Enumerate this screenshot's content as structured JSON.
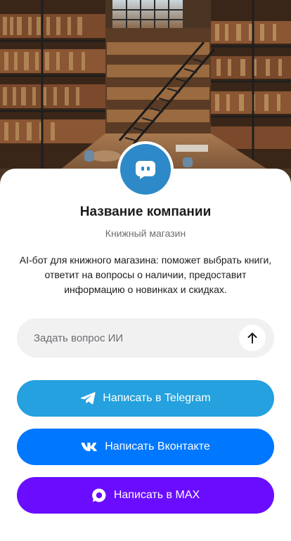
{
  "company": {
    "name": "Название компании",
    "category": "Книжный магазин",
    "description": "AI-бот для книжного магазина: поможет выбрать книги, ответит на вопросы о наличии, предоставит информацию о новинках и скидках."
  },
  "avatar": {
    "icon": "chat-bubble-icon",
    "color": "#2d89c8"
  },
  "ask": {
    "placeholder": "Задать вопрос ИИ",
    "value": "",
    "send_icon": "arrow-up-icon"
  },
  "buttons": {
    "telegram": {
      "label": "Написать в Telegram",
      "icon": "telegram-icon",
      "color": "#24a1de"
    },
    "vk": {
      "label": "Написать Вконтакте",
      "icon": "vk-icon",
      "color": "#0077ff"
    },
    "max": {
      "label": "Написать в MAX",
      "icon": "max-icon",
      "color": "#6a0dff"
    }
  },
  "hero": {
    "image": "library-interior-photo"
  }
}
